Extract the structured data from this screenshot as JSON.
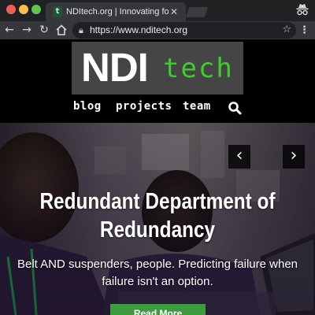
{
  "browser": {
    "tab_title": "NDItech.org | Innovating for De",
    "tab_favicon": "t",
    "tab_close": "✕",
    "url": "https://www.nditech.org",
    "icons": {
      "back": "arrow-left-icon",
      "forward": "arrow-right-icon",
      "reload": "reload-icon",
      "home": "home-icon",
      "lock": "lock-icon",
      "star": "star-icon",
      "menu": "kebab-menu-icon",
      "incognito": "incognito-icon"
    }
  },
  "site": {
    "logo_ndi": "NDI",
    "logo_tech": "tech",
    "nav": [
      "blog",
      "projects",
      "team"
    ],
    "nav_search_icon": "search-icon"
  },
  "hero": {
    "title_line1": "Redundant Department of",
    "title_line2": "Redundancy",
    "text_line1": "Belt AND suspenders, people. Predicting failure when",
    "text_line2": "failure isn't an option.",
    "button": "Read More",
    "prev": "‹",
    "next": "›"
  },
  "colors": {
    "brand_green": "#3fcc2f",
    "button_green": "#3f9b3f",
    "logo_bg": "#454545",
    "header_bg": "#000000"
  }
}
